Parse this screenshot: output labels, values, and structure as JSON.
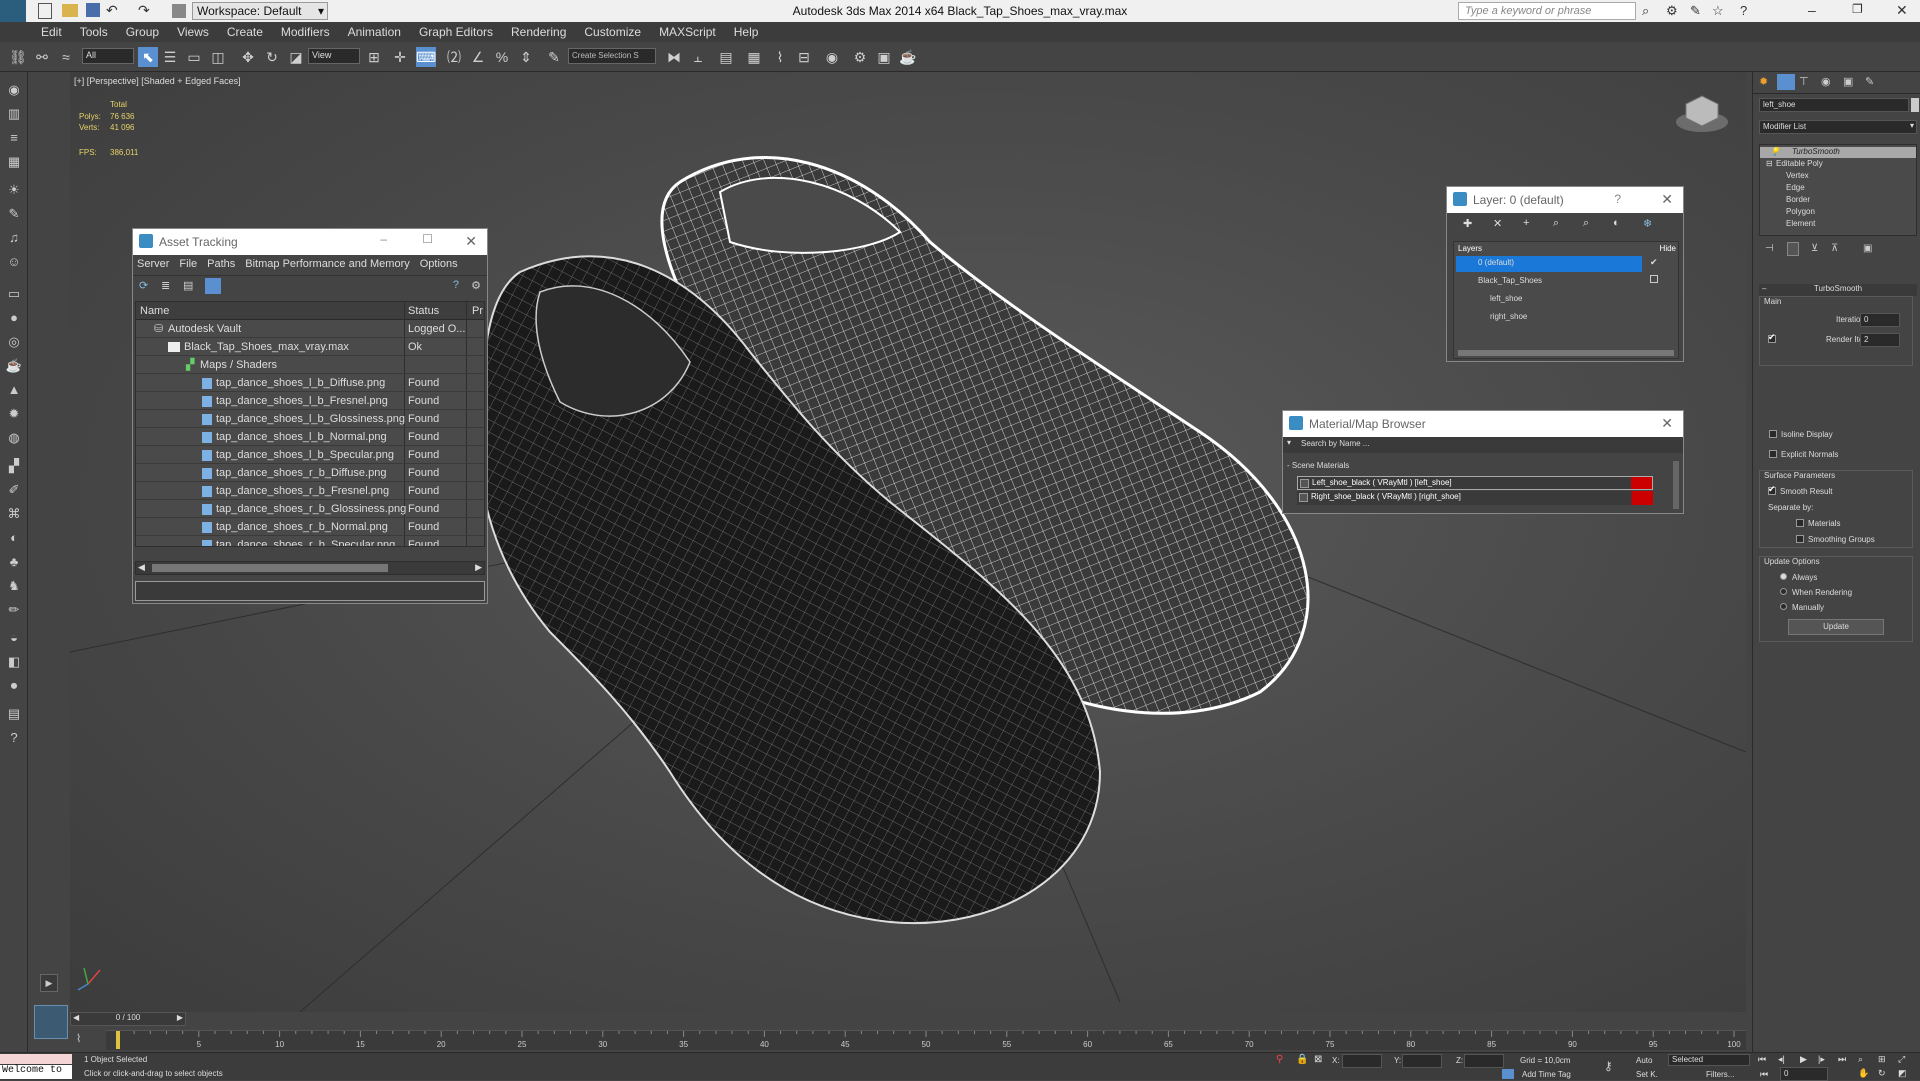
{
  "app": {
    "title": "Autodesk 3ds Max  2014 x64     Black_Tap_Shoes_max_vray.max",
    "workspace": "Workspace: Default",
    "search_placeholder": "Type a keyword or phrase"
  },
  "menu": [
    "Edit",
    "Tools",
    "Group",
    "Views",
    "Create",
    "Modifiers",
    "Animation",
    "Graph Editors",
    "Rendering",
    "Customize",
    "MAXScript",
    "Help"
  ],
  "toolbar": {
    "selection_filter": "All",
    "ref_coord": "View",
    "named_selection": "Create Selection S"
  },
  "viewport": {
    "label": "[+] [Perspective] [Shaded + Edged Faces]",
    "stats": {
      "total_label": "Total",
      "polys_label": "Polys:",
      "polys": "76 636",
      "verts_label": "Verts:",
      "verts": "41 096",
      "fps_label": "FPS:",
      "fps": "386,011"
    }
  },
  "asset_tracking": {
    "title": "Asset Tracking",
    "menu": [
      "Server",
      "File",
      "Paths",
      "Bitmap Performance and Memory",
      "Options"
    ],
    "columns": [
      "Name",
      "Status",
      "Pr"
    ],
    "rows": [
      {
        "name": "Autodesk Vault",
        "status": "Logged O..."
      },
      {
        "name": "Black_Tap_Shoes_max_vray.max",
        "status": "Ok"
      },
      {
        "name": "Maps / Shaders",
        "status": ""
      },
      {
        "name": "tap_dance_shoes_l_b_Diffuse.png",
        "status": "Found"
      },
      {
        "name": "tap_dance_shoes_l_b_Fresnel.png",
        "status": "Found"
      },
      {
        "name": "tap_dance_shoes_l_b_Glossiness.png",
        "status": "Found"
      },
      {
        "name": "tap_dance_shoes_l_b_Normal.png",
        "status": "Found"
      },
      {
        "name": "tap_dance_shoes_l_b_Specular.png",
        "status": "Found"
      },
      {
        "name": "tap_dance_shoes_r_b_Diffuse.png",
        "status": "Found"
      },
      {
        "name": "tap_dance_shoes_r_b_Fresnel.png",
        "status": "Found"
      },
      {
        "name": "tap_dance_shoes_r_b_Glossiness.png",
        "status": "Found"
      },
      {
        "name": "tap_dance_shoes_r_b_Normal.png",
        "status": "Found"
      },
      {
        "name": "tap_dance_shoes_r_b_Specular.png",
        "status": "Found"
      }
    ]
  },
  "layer_dialog": {
    "title": "Layer: 0 (default)",
    "help": "?",
    "col_layers": "Layers",
    "col_hide": "Hide",
    "layers": [
      "0 (default)",
      "Black_Tap_Shoes",
      "left_shoe",
      "right_shoe"
    ]
  },
  "material_browser": {
    "title": "Material/Map Browser",
    "search_placeholder": "Search by Name ...",
    "group": "- Scene Materials",
    "items": [
      "Left_shoe_black  ( VRayMtl ) [left_shoe]",
      "Right_shoe_black  ( VRayMtl ) [right_shoe]"
    ]
  },
  "command_panel": {
    "object_name": "left_shoe",
    "modifier_list": "Modifier List",
    "stack": [
      "TurboSmooth",
      "Editable Poly",
      "Vertex",
      "Edge",
      "Border",
      "Polygon",
      "Element"
    ],
    "rollout_title": "TurboSmooth",
    "main_label": "Main",
    "iterations_label": "Iterations:",
    "iterations": "0",
    "render_iters_label": "Render Iters:",
    "render_iters": "2",
    "isoline": "Isoline Display",
    "explicit_normals": "Explicit Normals",
    "surface_params": "Surface Parameters",
    "smooth_result": "Smooth Result",
    "separate_by": "Separate by:",
    "materials": "Materials",
    "smoothing_groups": "Smoothing Groups",
    "update_options": "Update Options",
    "always": "Always",
    "when_rendering": "When Rendering",
    "manually": "Manually",
    "update_button": "Update"
  },
  "timeline": {
    "frame": "0 / 100",
    "ticks": [
      "0",
      "5",
      "10",
      "15",
      "20",
      "25",
      "30",
      "35",
      "40",
      "45",
      "50",
      "55",
      "60",
      "65",
      "70",
      "75",
      "80",
      "85",
      "90",
      "95",
      "100"
    ]
  },
  "status": {
    "welcome": "Welcome to",
    "selected": "1 Object Selected",
    "prompt": "Click or click-and-drag to select objects",
    "x_label": "X:",
    "y_label": "Y:",
    "z_label": "Z:",
    "grid": "Grid = 10,0cm",
    "add_time_tag": "Add Time Tag",
    "auto": "Auto",
    "set_key": "Set K.",
    "selected_dd": "Selected",
    "filters": "Filters...",
    "frame_field": "0"
  }
}
